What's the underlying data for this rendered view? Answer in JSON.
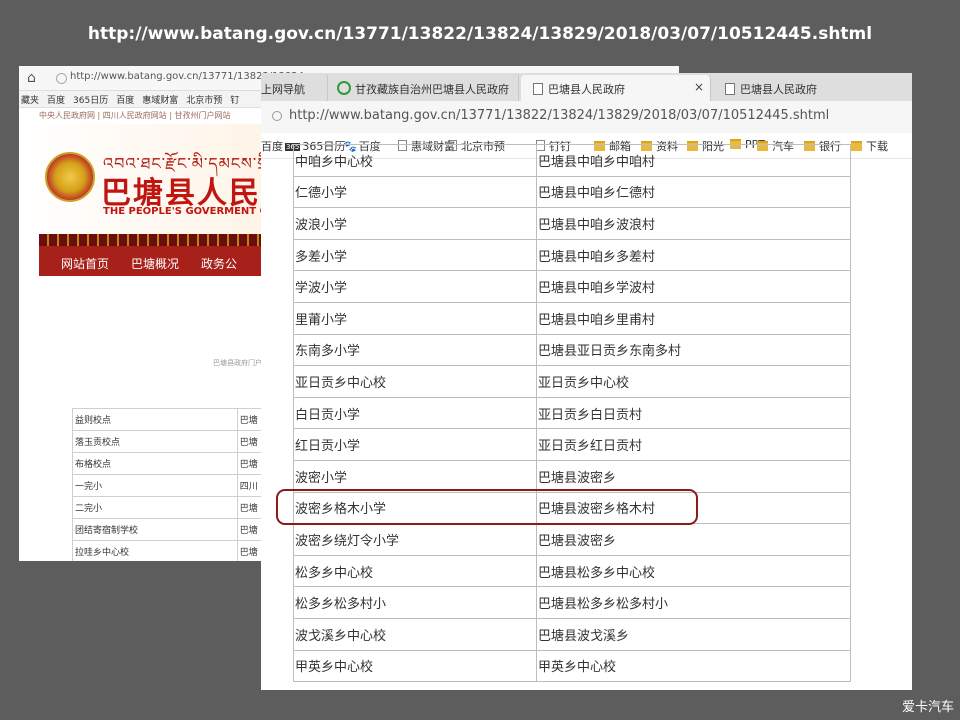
{
  "caption": {
    "url": "http://www.batang.gov.cn/13771/13822/13824/13829/2018/03/07/10512445.shtml"
  },
  "watermark": "爱卡汽车",
  "back_shot": {
    "url": "http://www.batang.gov.cn/13771/13822/13824",
    "bookmarks": [
      "藏夹",
      "百度",
      "365日历",
      "百度",
      "惠域财富",
      "北京市预",
      "钉"
    ],
    "breadcrumb_tiny": "中央人民政府网 | 四川人民政府网站 | 甘孜州门户网站",
    "tibetan_title": "འབའ་ཐང་རྫོང་མི་དམངས་སྲིད་",
    "site_title": "巴塘县人民政",
    "site_subtitle": "THE PEOPLE'S GOVERMENT OF BA",
    "nav": [
      "网站首页",
      "巴塘概况",
      "政务公"
    ],
    "gov_label": "巴塘县政府门户",
    "table_rows": [
      [
        "益则校点",
        "巴塘"
      ],
      [
        "落玉贡校点",
        "巴塘"
      ],
      [
        "布格校点",
        "巴塘"
      ],
      [
        "一完小",
        "四川"
      ],
      [
        "二完小",
        "巴塘"
      ],
      [
        "团结寄宿制学校",
        "巴塘"
      ],
      [
        "拉哇乡中心校",
        "巴塘"
      ]
    ]
  },
  "front_shot": {
    "tabs": [
      {
        "label": "上网导航"
      },
      {
        "label": "甘孜藏族自治州巴塘县人民政府"
      },
      {
        "label": "巴塘县人民政府",
        "close": "×"
      },
      {
        "label": "巴塘县人民政府"
      }
    ],
    "url": "http://www.batang.gov.cn/13771/13822/13824/13829/2018/03/07/10512445.shtml",
    "bookmarks": [
      {
        "label": "百度",
        "icon": "none"
      },
      {
        "label": "365日历",
        "icon": "calendar-icon"
      },
      {
        "label": "百度",
        "icon": "paw-icon"
      },
      {
        "label": "惠域财富",
        "icon": "page-icon"
      },
      {
        "label": "北京市预",
        "icon": "page-icon"
      },
      {
        "label": "钉钉",
        "icon": "page-icon"
      },
      {
        "label": "邮箱",
        "icon": "folder-icon"
      },
      {
        "label": "资料",
        "icon": "folder-icon"
      },
      {
        "label": "阳光",
        "icon": "folder-icon"
      },
      {
        "label": "PPT",
        "icon": "folder-icon"
      },
      {
        "label": "汽车",
        "icon": "folder-icon"
      },
      {
        "label": "银行",
        "icon": "folder-icon"
      },
      {
        "label": "下载",
        "icon": "folder-icon"
      }
    ],
    "table_rows": [
      [
        "中咱乡中心校",
        "巴塘县中咱乡中咱村"
      ],
      [
        "仁德小学",
        "巴塘县中咱乡仁德村"
      ],
      [
        "波浪小学",
        "巴塘县中咱乡波浪村"
      ],
      [
        "多差小学",
        "巴塘县中咱乡多差村"
      ],
      [
        "学波小学",
        "巴塘县中咱乡学波村"
      ],
      [
        "里莆小学",
        "巴塘县中咱乡里甫村"
      ],
      [
        "东南多小学",
        "巴塘县亚日贡乡东南多村"
      ],
      [
        "亚日贡乡中心校",
        "亚日贡乡中心校"
      ],
      [
        "白日贡小学",
        "亚日贡乡白日贡村"
      ],
      [
        "红日贡小学",
        "亚日贡乡红日贡村"
      ],
      [
        "波密小学",
        "巴塘县波密乡"
      ],
      [
        "波密乡格木小学",
        "巴塘县波密乡格木村"
      ],
      [
        "波密乡绕灯令小学",
        "巴塘县波密乡"
      ],
      [
        "松多乡中心校",
        "巴塘县松多乡中心校"
      ],
      [
        "松多乡松多村小",
        "巴塘县松多乡松多村小"
      ],
      [
        "波戈溪乡中心校",
        "巴塘县波戈溪乡"
      ],
      [
        "甲英乡中心校",
        "甲英乡中心校"
      ]
    ],
    "highlighted_row_index": 11
  },
  "colors": {
    "background": "#5d5d5d",
    "banner_red": "#c0160f",
    "nav_red": "#a8201a",
    "highlight": "#8b1a1a"
  }
}
